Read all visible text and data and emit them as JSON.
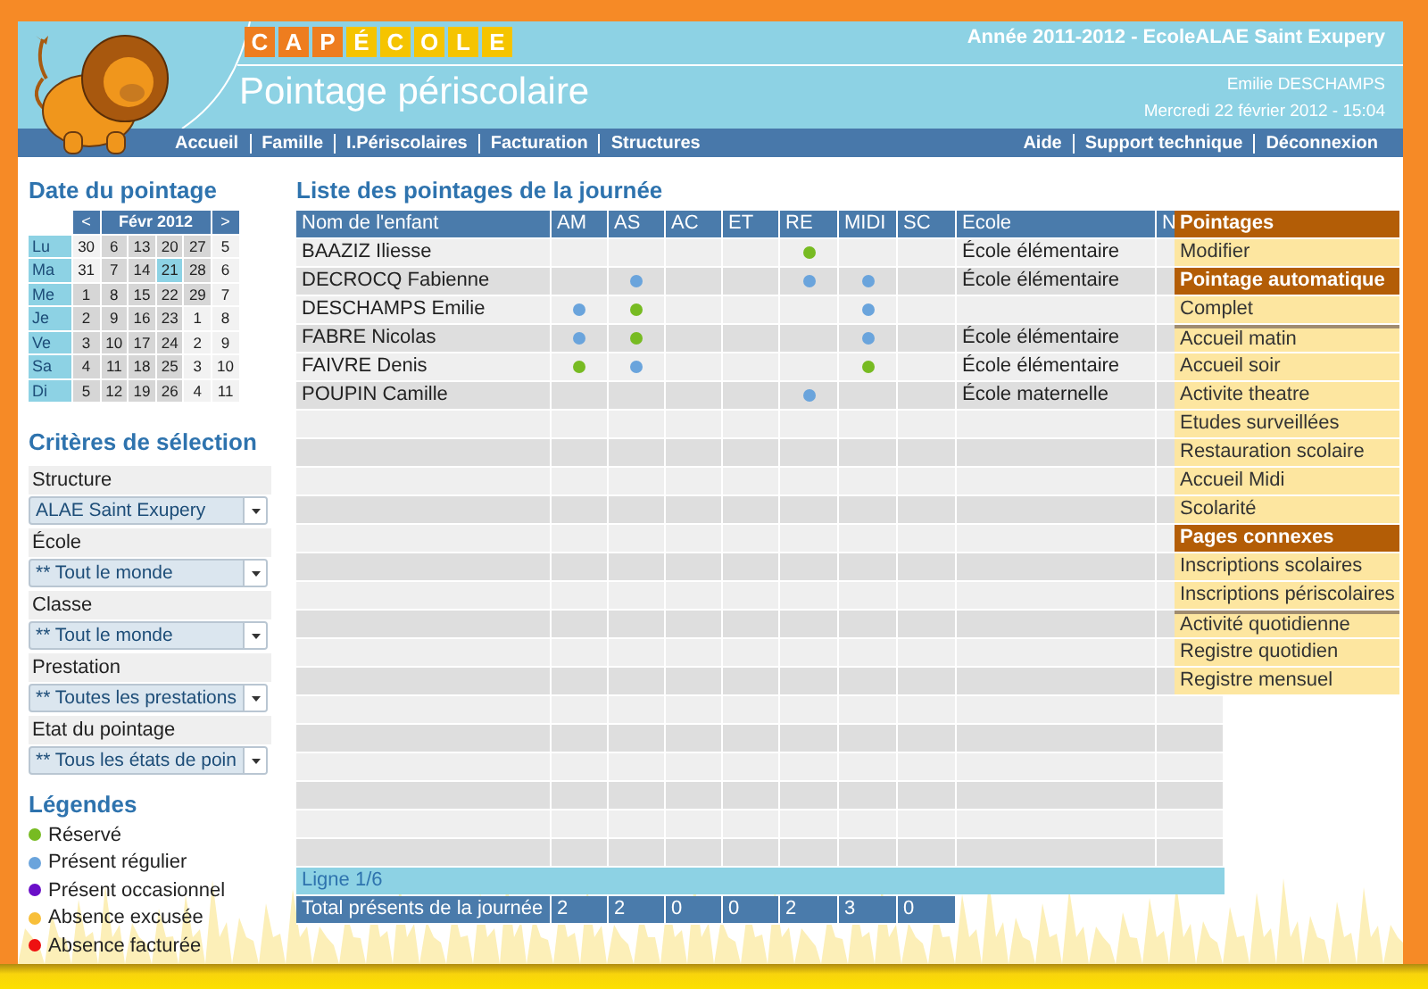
{
  "header": {
    "logo_letters": [
      {
        "char": "C",
        "color": "#ee7d1f"
      },
      {
        "char": "A",
        "color": "#ee7d1f"
      },
      {
        "char": "P",
        "color": "#ee7d1f"
      },
      {
        "char": "É",
        "color": "#f5c400"
      },
      {
        "char": "C",
        "color": "#f5c400"
      },
      {
        "char": "O",
        "color": "#f5c400"
      },
      {
        "char": "L",
        "color": "#f5c400"
      },
      {
        "char": "E",
        "color": "#f5c400"
      }
    ],
    "title": "Pointage périscolaire",
    "school_year": "Année 2011-2012 - EcoleALAE Saint Exupery",
    "user": "Emilie DESCHAMPS",
    "datetime": "Mercredi 22 février 2012 - 15:04"
  },
  "nav": {
    "left": [
      "Accueil",
      "Famille",
      "I.Périscolaires",
      "Facturation",
      "Structures"
    ],
    "right": [
      "Aide",
      "Support technique",
      "Déconnexion"
    ]
  },
  "sidebar": {
    "date_title": "Date du pointage",
    "calendar": {
      "prev": "<",
      "month": "Févr 2012",
      "next": ">",
      "rows": [
        {
          "day": "Lu",
          "dates": [
            {
              "d": "30",
              "in_month": false,
              "selected": false
            },
            {
              "d": "6",
              "in_month": true,
              "selected": false
            },
            {
              "d": "13",
              "in_month": true,
              "selected": false
            },
            {
              "d": "20",
              "in_month": true,
              "selected": false
            },
            {
              "d": "27",
              "in_month": true,
              "selected": false
            },
            {
              "d": "5",
              "in_month": false,
              "selected": false
            }
          ]
        },
        {
          "day": "Ma",
          "dates": [
            {
              "d": "31",
              "in_month": false,
              "selected": false
            },
            {
              "d": "7",
              "in_month": true,
              "selected": false
            },
            {
              "d": "14",
              "in_month": true,
              "selected": false
            },
            {
              "d": "21",
              "in_month": true,
              "selected": true
            },
            {
              "d": "28",
              "in_month": true,
              "selected": false
            },
            {
              "d": "6",
              "in_month": false,
              "selected": false
            }
          ]
        },
        {
          "day": "Me",
          "dates": [
            {
              "d": "1",
              "in_month": true,
              "selected": false
            },
            {
              "d": "8",
              "in_month": true,
              "selected": false
            },
            {
              "d": "15",
              "in_month": true,
              "selected": false
            },
            {
              "d": "22",
              "in_month": true,
              "selected": false
            },
            {
              "d": "29",
              "in_month": true,
              "selected": false
            },
            {
              "d": "7",
              "in_month": false,
              "selected": false
            }
          ]
        },
        {
          "day": "Je",
          "dates": [
            {
              "d": "2",
              "in_month": true,
              "selected": false
            },
            {
              "d": "9",
              "in_month": true,
              "selected": false
            },
            {
              "d": "16",
              "in_month": true,
              "selected": false
            },
            {
              "d": "23",
              "in_month": true,
              "selected": false
            },
            {
              "d": "1",
              "in_month": false,
              "selected": false
            },
            {
              "d": "8",
              "in_month": false,
              "selected": false
            }
          ]
        },
        {
          "day": "Ve",
          "dates": [
            {
              "d": "3",
              "in_month": true,
              "selected": false
            },
            {
              "d": "10",
              "in_month": true,
              "selected": false
            },
            {
              "d": "17",
              "in_month": true,
              "selected": false
            },
            {
              "d": "24",
              "in_month": true,
              "selected": false
            },
            {
              "d": "2",
              "in_month": false,
              "selected": false
            },
            {
              "d": "9",
              "in_month": false,
              "selected": false
            }
          ]
        },
        {
          "day": "Sa",
          "dates": [
            {
              "d": "4",
              "in_month": true,
              "selected": false
            },
            {
              "d": "11",
              "in_month": true,
              "selected": false
            },
            {
              "d": "18",
              "in_month": true,
              "selected": false
            },
            {
              "d": "25",
              "in_month": true,
              "selected": false
            },
            {
              "d": "3",
              "in_month": false,
              "selected": false
            },
            {
              "d": "10",
              "in_month": false,
              "selected": false
            }
          ]
        },
        {
          "day": "Di",
          "dates": [
            {
              "d": "5",
              "in_month": true,
              "selected": false
            },
            {
              "d": "12",
              "in_month": true,
              "selected": false
            },
            {
              "d": "19",
              "in_month": true,
              "selected": false
            },
            {
              "d": "26",
              "in_month": true,
              "selected": false
            },
            {
              "d": "4",
              "in_month": false,
              "selected": false
            },
            {
              "d": "11",
              "in_month": false,
              "selected": false
            }
          ]
        }
      ]
    },
    "criteria_title": "Critères de sélection",
    "criteria": [
      {
        "label": "Structure",
        "value": "ALAE Saint Exupery"
      },
      {
        "label": "École",
        "value": "** Tout le monde"
      },
      {
        "label": "Classe",
        "value": "** Tout le monde"
      },
      {
        "label": "Prestation",
        "value": "** Toutes les prestations"
      },
      {
        "label": "Etat du pointage",
        "value": "** Tous les états de poin"
      }
    ],
    "legend_title": "Légendes",
    "legend": [
      {
        "label": "Réservé",
        "color": "#77bb22"
      },
      {
        "label": "Présent régulier",
        "color": "#6aa4dc"
      },
      {
        "label": "Présent occasionnel",
        "color": "#6a0fc8"
      },
      {
        "label": "Absence excusée",
        "color": "#f8bf3a"
      },
      {
        "label": "Absence facturée",
        "color": "#ee1111"
      }
    ]
  },
  "table": {
    "title": "Liste des pointages de la journée",
    "columns": [
      "Nom de l'enfant",
      "AM",
      "AS",
      "AC",
      "ET",
      "RE",
      "MIDI",
      "SC",
      "Ecole",
      "N"
    ],
    "rows": [
      {
        "name": "BAAZIZ Iliesse",
        "slots": [
          {
            "dot": false
          },
          {
            "dot": false
          },
          {
            "dot": false
          },
          {
            "dot": false
          },
          {
            "dot": true,
            "color": "#77bb22"
          },
          {
            "dot": false
          },
          {
            "dot": false
          }
        ],
        "school": "École élémentaire"
      },
      {
        "name": "DECROCQ Fabienne",
        "slots": [
          {
            "dot": false
          },
          {
            "dot": true,
            "color": "#6aa4dc"
          },
          {
            "dot": false
          },
          {
            "dot": false
          },
          {
            "dot": true,
            "color": "#6aa4dc"
          },
          {
            "dot": true,
            "color": "#6aa4dc"
          },
          {
            "dot": false
          }
        ],
        "school": "École élémentaire"
      },
      {
        "name": "DESCHAMPS Emilie",
        "slots": [
          {
            "dot": true,
            "color": "#6aa4dc"
          },
          {
            "dot": true,
            "color": "#77bb22"
          },
          {
            "dot": false
          },
          {
            "dot": false
          },
          {
            "dot": false
          },
          {
            "dot": true,
            "color": "#6aa4dc"
          },
          {
            "dot": false
          }
        ]
      },
      {
        "name": "FABRE Nicolas",
        "slots": [
          {
            "dot": true,
            "color": "#6aa4dc"
          },
          {
            "dot": true,
            "color": "#77bb22"
          },
          {
            "dot": false
          },
          {
            "dot": false
          },
          {
            "dot": false
          },
          {
            "dot": true,
            "color": "#6aa4dc"
          },
          {
            "dot": false
          }
        ],
        "school": "École élémentaire"
      },
      {
        "name": "FAIVRE Denis",
        "slots": [
          {
            "dot": true,
            "color": "#77bb22"
          },
          {
            "dot": true,
            "color": "#6aa4dc"
          },
          {
            "dot": false
          },
          {
            "dot": false
          },
          {
            "dot": false
          },
          {
            "dot": true,
            "color": "#77bb22"
          },
          {
            "dot": false
          }
        ],
        "school": "École élémentaire"
      },
      {
        "name": "POUPIN Camille",
        "slots": [
          {
            "dot": false
          },
          {
            "dot": false
          },
          {
            "dot": false
          },
          {
            "dot": false
          },
          {
            "dot": true,
            "color": "#6aa4dc"
          },
          {
            "dot": false
          },
          {
            "dot": false
          }
        ],
        "school": "École maternelle"
      }
    ],
    "pager": "Ligne 1/6",
    "totals_label": "Total présents de la journée",
    "totals": [
      "2",
      "2",
      "0",
      "0",
      "2",
      "3",
      "0"
    ]
  },
  "menu": [
    {
      "title": "Pointages",
      "items": [
        {
          "label": "Modifier",
          "divider_above": false
        }
      ]
    },
    {
      "title": "Pointage automatique",
      "items": [
        {
          "label": "Complet",
          "divider_above": false
        },
        {
          "label": "Accueil matin",
          "divider_above": true
        },
        {
          "label": "Accueil soir",
          "divider_above": false
        },
        {
          "label": "Activite theatre",
          "divider_above": false
        },
        {
          "label": "Etudes surveillées",
          "divider_above": false
        },
        {
          "label": "Restauration scolaire",
          "divider_above": false
        },
        {
          "label": "Accueil Midi",
          "divider_above": false
        },
        {
          "label": "Scolarité",
          "divider_above": false
        }
      ]
    },
    {
      "title": "Pages connexes",
      "items": [
        {
          "label": "Inscriptions scolaires",
          "divider_above": false
        },
        {
          "label": "Inscriptions périscolaires",
          "divider_above": false
        },
        {
          "label": "Activité quotidienne",
          "divider_above": true
        },
        {
          "label": "Registre quotidien",
          "divider_above": false
        },
        {
          "label": "Registre mensuel",
          "divider_above": false
        }
      ]
    }
  ]
}
